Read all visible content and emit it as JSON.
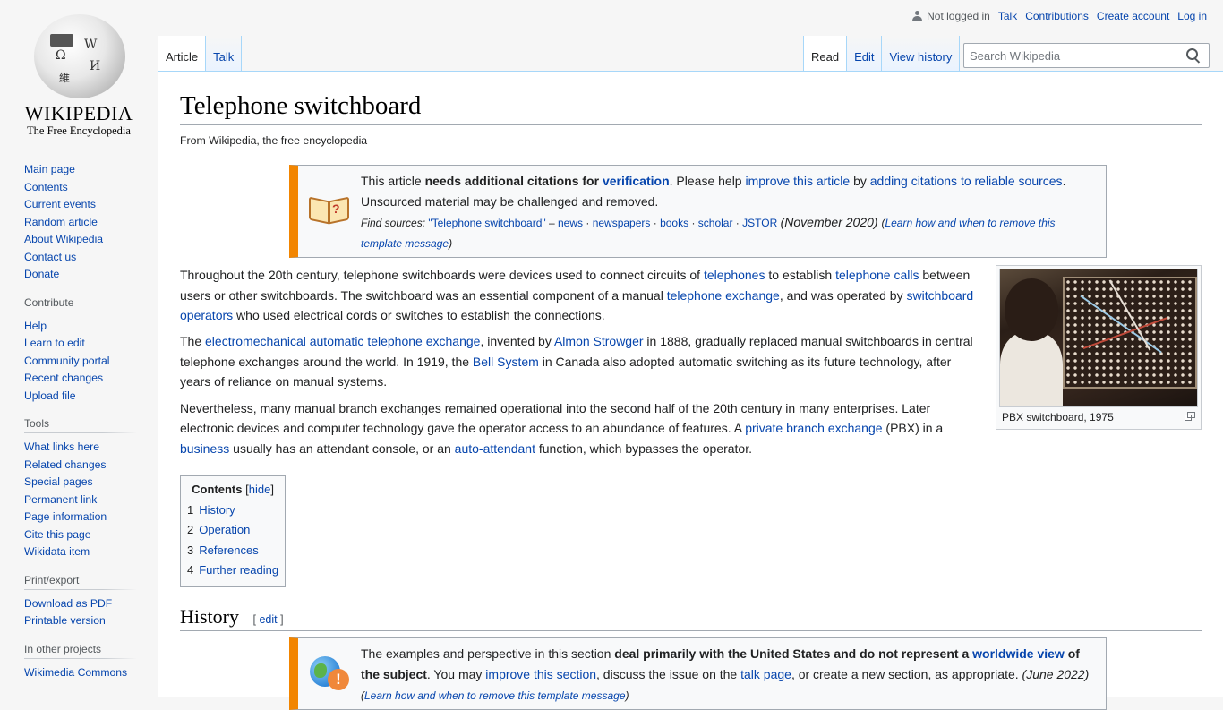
{
  "logo": {
    "wordmark": "WIKIPEDIA",
    "tagline": "The Free Encyclopedia",
    "globe_glyphs": [
      "Ω",
      "W",
      "И",
      "維"
    ]
  },
  "personal": {
    "status": "Not logged in",
    "links": [
      "Talk",
      "Contributions",
      "Create account",
      "Log in"
    ]
  },
  "tabs": {
    "left": [
      {
        "label": "Article",
        "selected": true
      },
      {
        "label": "Talk",
        "selected": false
      }
    ],
    "right": [
      {
        "label": "Read",
        "selected": true
      },
      {
        "label": "Edit",
        "selected": false
      },
      {
        "label": "View history",
        "selected": false
      }
    ]
  },
  "search": {
    "placeholder": "Search Wikipedia",
    "value": ""
  },
  "sidebar": {
    "navigation": [
      "Main page",
      "Contents",
      "Current events",
      "Random article",
      "About Wikipedia",
      "Contact us",
      "Donate"
    ],
    "contribute": {
      "heading": "Contribute",
      "items": [
        "Help",
        "Learn to edit",
        "Community portal",
        "Recent changes",
        "Upload file"
      ]
    },
    "tools": {
      "heading": "Tools",
      "items": [
        "What links here",
        "Related changes",
        "Special pages",
        "Permanent link",
        "Page information",
        "Cite this page",
        "Wikidata item"
      ]
    },
    "print": {
      "heading": "Print/export",
      "items": [
        "Download as PDF",
        "Printable version"
      ]
    },
    "projects": {
      "heading": "In other projects",
      "items": [
        "Wikimedia Commons"
      ]
    }
  },
  "article": {
    "title": "Telephone switchboard",
    "site_sub": "From Wikipedia, the free encyclopedia",
    "notice1": {
      "t1": "This article ",
      "b1": "needs additional citations for ",
      "l1": "verification",
      "t2": ". Please help ",
      "l2": "improve this article",
      "t3": " by ",
      "l3": "adding citations to reliable sources",
      "t4": ".",
      "line2": "Unsourced material may be challenged and removed.",
      "find_label": "Find sources:",
      "find_query": "\"Telephone switchboard\"",
      "dash": " – ",
      "sources": [
        "news",
        "newspapers",
        "books",
        "scholar",
        "JSTOR"
      ],
      "date": "(November 2020)",
      "learn": "Learn how and when to remove this template message"
    },
    "paragraphs": {
      "p1": {
        "a": "Throughout the 20th century, telephone switchboards were devices used to connect circuits of ",
        "l1": "telephones",
        "b": " to establish ",
        "l2": "telephone calls",
        "c": " between users or other switchboards. The switchboard was an essential component of a manual ",
        "l3": "telephone exchange",
        "d": ", and was operated by ",
        "l4": "switchboard operators",
        "e": " who used electrical cords or switches to establish the connections."
      },
      "p2": {
        "a": "The ",
        "l1": "electromechanical automatic telephone exchange",
        "b": ", invented by ",
        "l2": "Almon Strowger",
        "c": " in 1888, gradually replaced manual switchboards in central telephone exchanges around the world. In 1919, the ",
        "l3": "Bell System",
        "d": " in Canada also adopted automatic switching as its future technology, after years of reliance on manual systems."
      },
      "p3": {
        "a": "Nevertheless, many manual branch exchanges remained operational into the second half of the 20th century in many enterprises. Later electronic devices and computer technology gave the operator access to an abundance of features. A ",
        "l1": "private branch exchange",
        "b": " (PBX) in a ",
        "l2": "business",
        "c": " usually has an attendant console, or an ",
        "l3": "auto-attendant",
        "d": " function, which bypasses the operator."
      }
    },
    "figure": {
      "caption": "PBX switchboard, 1975"
    },
    "toc": {
      "title": "Contents",
      "toggle": "hide",
      "items": [
        {
          "num": "1",
          "label": "History"
        },
        {
          "num": "2",
          "label": "Operation"
        },
        {
          "num": "3",
          "label": "References"
        },
        {
          "num": "4",
          "label": "Further reading"
        }
      ]
    },
    "history": {
      "heading": "History",
      "edit": "edit",
      "notice2": {
        "t1": "The examples and perspective in this section ",
        "b1": "deal primarily with the United States and do not represent a ",
        "l1": "worldwide view",
        "b2": " of the subject",
        "t2": ". You may ",
        "l2": "improve this section",
        "t3": ", discuss the issue on the ",
        "l3": "talk page",
        "t4": ", or create a new section, as appropriate. ",
        "date": "(June 2022)",
        "learn": "Learn how and when to remove this template message"
      }
    }
  }
}
